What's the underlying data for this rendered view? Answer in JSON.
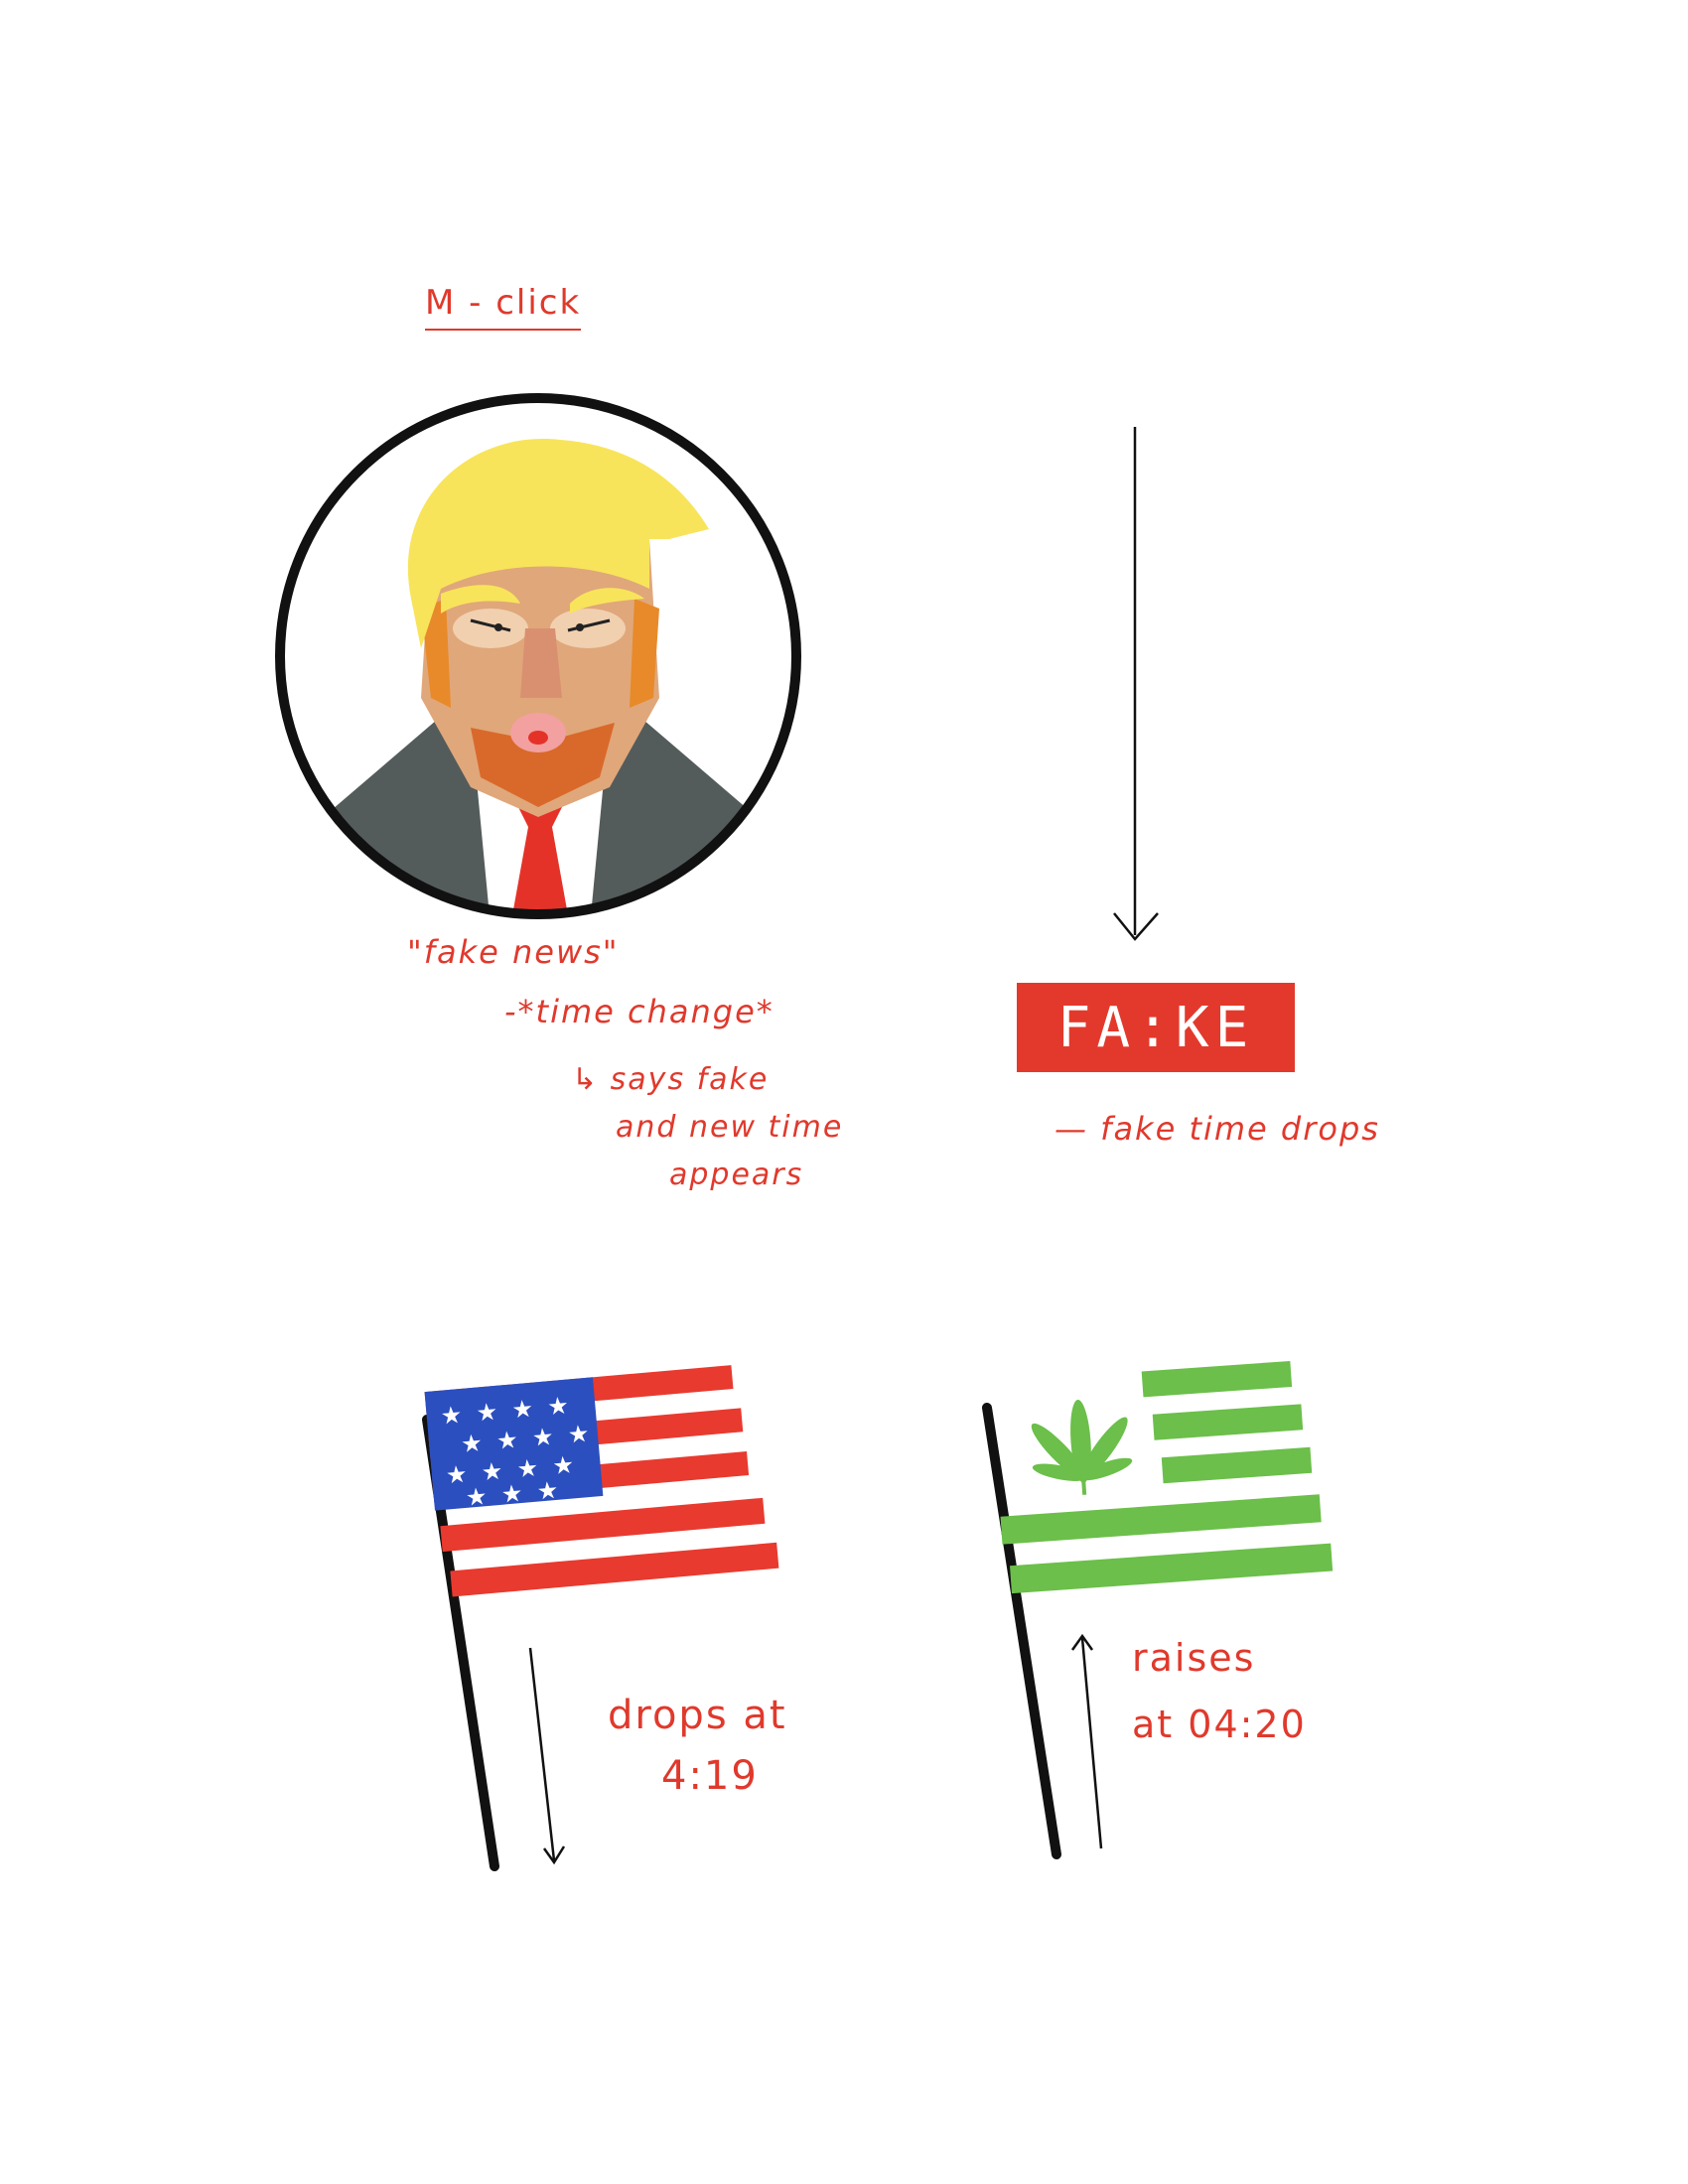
{
  "sketch": {
    "trigger_label": "M - click",
    "portrait_notes": [
      "\"fake news\"",
      "-*time change*",
      "↳ says fake",
      "and new time",
      "appears"
    ],
    "fake_badge": {
      "text": "FA:KE",
      "color": "#e3392c"
    },
    "fake_note": "— fake time drops",
    "us_flag_note": [
      "drops at",
      "4:19"
    ],
    "cannabis_flag_note": [
      "raises",
      "at 04:20"
    ]
  },
  "colors": {
    "annotation": "#e0392c",
    "us_red": "#e83a2f",
    "us_blue": "#2b4fbf",
    "cannabis_green": "#6bbf4a"
  },
  "icons": [
    "portrait-icon",
    "us-flag-icon",
    "cannabis-flag-icon",
    "down-arrow-icon",
    "up-arrow-icon"
  ]
}
